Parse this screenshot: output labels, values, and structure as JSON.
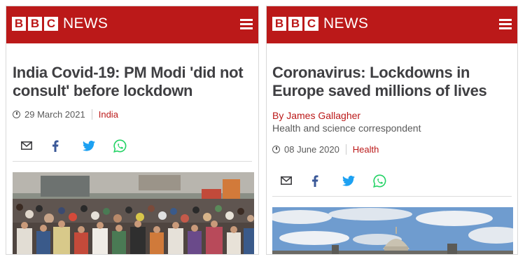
{
  "left": {
    "brand": {
      "b1": "B",
      "b2": "B",
      "b3": "C",
      "news": "NEWS"
    },
    "headline": "India Covid-19: PM Modi 'did not consult' before lockdown",
    "date": "29 March 2021",
    "category": "India",
    "photo_alt": "Crowd of people wearing masks in a street"
  },
  "right": {
    "brand": {
      "b1": "B",
      "b2": "B",
      "b3": "C",
      "news": "NEWS"
    },
    "headline": "Coronavirus: Lockdowns in Europe saved millions of lives",
    "author": "By James Gallagher",
    "role": "Health and science correspondent",
    "date": "08 June 2020",
    "category": "Health",
    "photo_alt": "City skyline with dome under cloudy sky"
  },
  "icons": {
    "menu": "hamburger-icon",
    "email": "email-icon",
    "facebook": "facebook-icon",
    "twitter": "twitter-icon",
    "whatsapp": "whatsapp-icon",
    "clock": "clock-icon"
  },
  "colors": {
    "brand_red": "#bb1919",
    "headline": "#3f3f42",
    "meta": "#5a5a5a",
    "facebook": "#3b5998",
    "twitter": "#1da1f2",
    "whatsapp": "#25d366"
  }
}
